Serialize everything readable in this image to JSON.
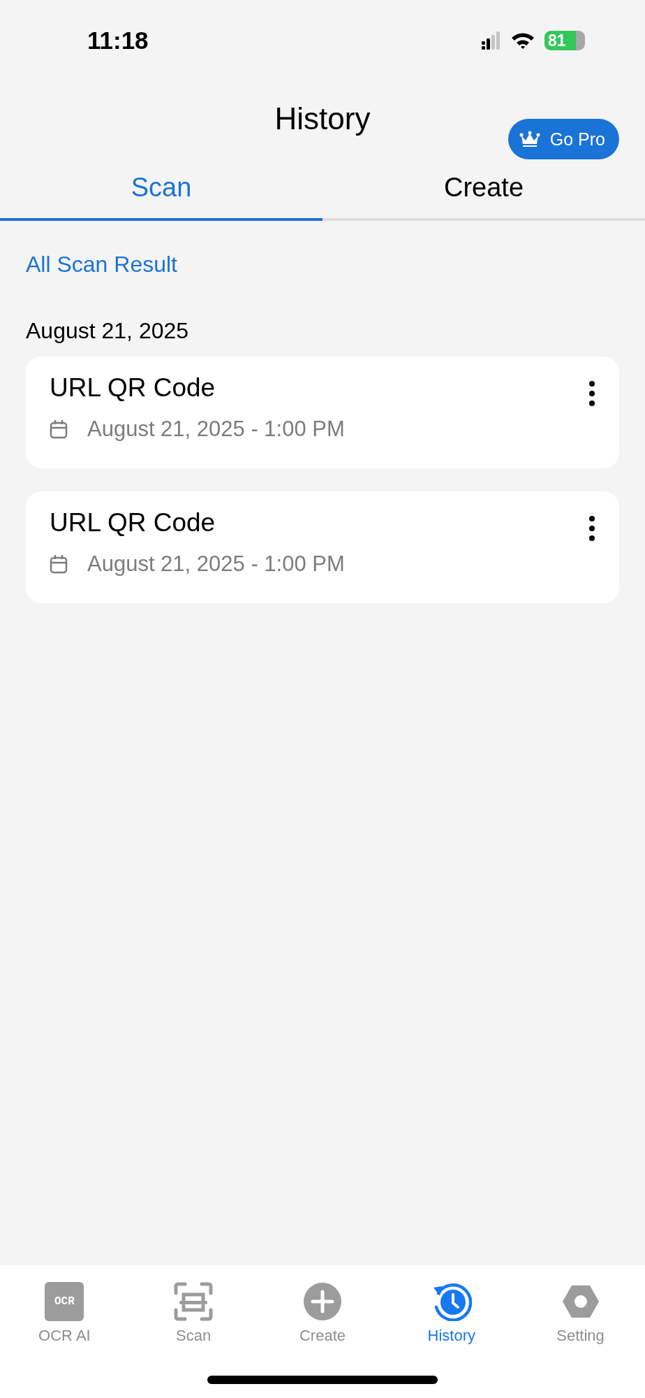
{
  "status_bar": {
    "time": "11:18",
    "battery": "81"
  },
  "header": {
    "title": "History",
    "pro_button": "Go Pro"
  },
  "tabs": [
    {
      "label": "Scan",
      "selected": true
    },
    {
      "label": "Create",
      "selected": false
    }
  ],
  "filter_link": "All Scan Result",
  "sections": [
    {
      "date": "August 21, 2025",
      "items": [
        {
          "title": "URL QR Code",
          "timestamp": "August 21, 2025 - 1:00 PM"
        },
        {
          "title": "URL QR Code",
          "timestamp": "August 21, 2025 - 1:00 PM"
        }
      ]
    }
  ],
  "bottom_nav": [
    {
      "kind": "ocr",
      "icon_text": "OCR",
      "label": "OCR AI",
      "selected": false
    },
    {
      "kind": "scan",
      "label": "Scan",
      "selected": false
    },
    {
      "kind": "create",
      "label": "Create",
      "selected": false
    },
    {
      "kind": "history",
      "label": "History",
      "selected": true
    },
    {
      "kind": "setting",
      "label": "Setting",
      "selected": false
    }
  ]
}
